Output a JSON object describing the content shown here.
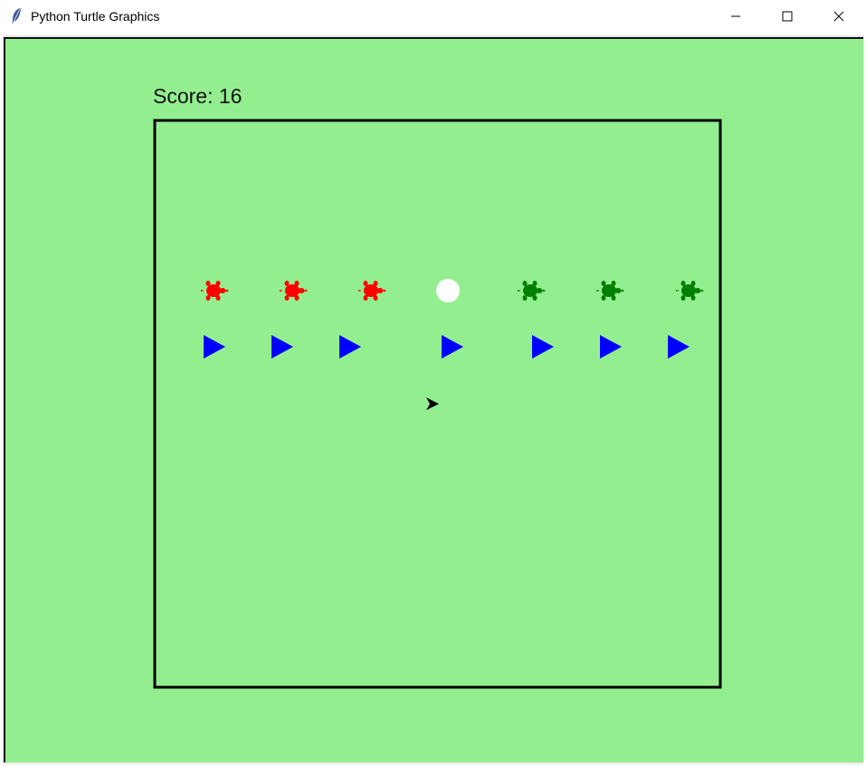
{
  "window": {
    "title": "Python Turtle Graphics",
    "icon": "feather-icon",
    "controls": [
      "minimize-icon",
      "maximize-icon",
      "close-icon"
    ]
  },
  "game": {
    "score_text": "Score: 16",
    "background_color": "#93ee8f",
    "border_color": "#000000",
    "red_turtles": 3,
    "green_turtles": 3,
    "blue_triangles": 7,
    "colors": {
      "red": "#ff0000",
      "green": "#008000",
      "blue": "#0000ff",
      "ball": "#ffffff",
      "player": "#000000"
    }
  }
}
